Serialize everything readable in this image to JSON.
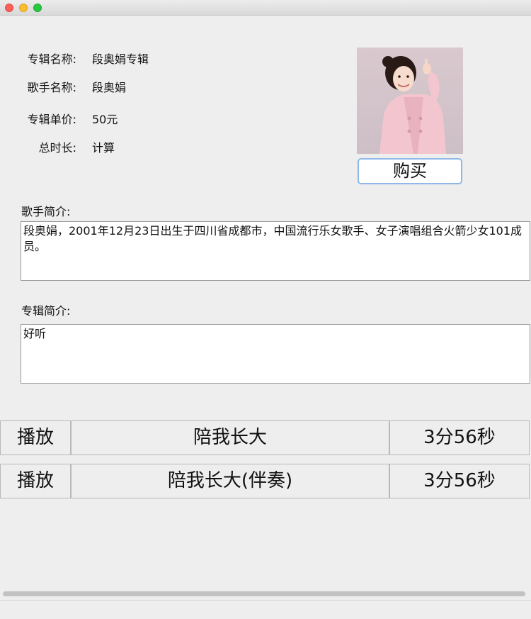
{
  "window": {
    "traffic_lights": [
      "close",
      "minimize",
      "maximize"
    ]
  },
  "album_info": {
    "album_name_label": "专辑名称:",
    "album_name_value": "段奥娟专辑",
    "singer_name_label": "歌手名称:",
    "singer_name_value": "段奥娟",
    "price_label": "专辑单价:",
    "price_value": "50元",
    "duration_label": "总时长:",
    "duration_value": "计算"
  },
  "cover": {
    "icon": "singer-photo"
  },
  "buy_button_label": "购买",
  "singer_intro": {
    "label": "歌手简介:",
    "text": "段奥娟，2001年12月23日出生于四川省成都市，中国流行乐女歌手、女子演唱组合火箭少女101成员。"
  },
  "album_intro": {
    "label": "专辑简介:",
    "text": "好听"
  },
  "tracks": [
    {
      "action": "播放",
      "title": "陪我长大",
      "duration": "3分56秒"
    },
    {
      "action": "播放",
      "title": "陪我长大(伴奏)",
      "duration": "3分56秒"
    }
  ]
}
